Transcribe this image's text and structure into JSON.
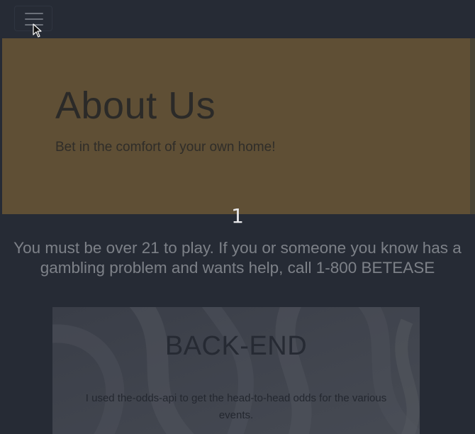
{
  "nav": {
    "menu_icon": "hamburger-menu-icon"
  },
  "hero": {
    "title": "About Us",
    "subtitle": "Bet in the comfort of your own home!"
  },
  "page_number": "1",
  "warning": "You must be over 21 to play. If you or someone you know has a gambling problem and wants help, call 1-800 BETEASE",
  "card": {
    "title": "BACK-END",
    "text": "I used the-odds-api to get the head-to-head odds for the various events."
  },
  "colors": {
    "page_background": "#262b35",
    "hero_background": "#5f4f35",
    "card_background": "#3a3e48"
  }
}
